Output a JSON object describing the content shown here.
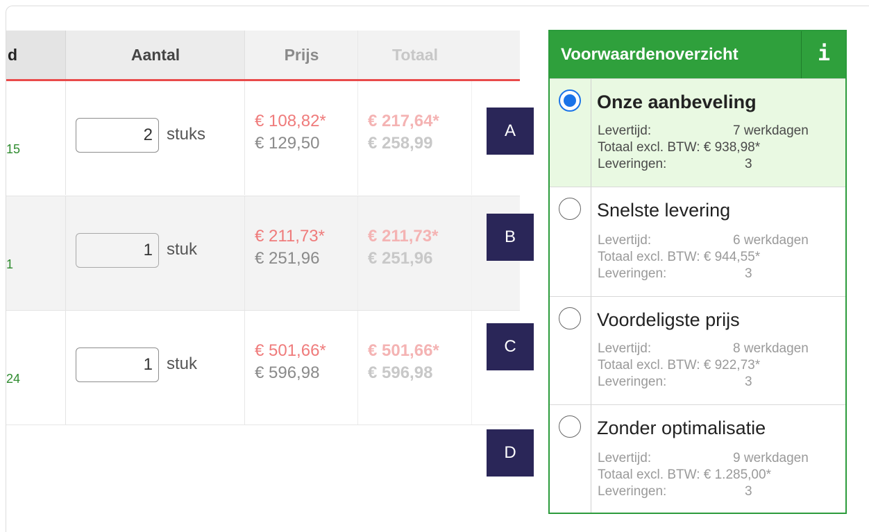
{
  "table": {
    "headers": {
      "first": "d",
      "aantal": "Aantal",
      "prijs": "Prijs",
      "totaal": "Totaal"
    },
    "rows": [
      {
        "code": "15",
        "qty": "2",
        "unit": "stuks",
        "price_sale": "€ 108,82*",
        "price_regular": "€ 129,50",
        "total_sale": "€ 217,64*",
        "total_regular": "€ 258,99"
      },
      {
        "code": "1",
        "qty": "1",
        "unit": "stuk",
        "price_sale": "€ 211,73*",
        "price_regular": "€ 251,96",
        "total_sale": "€ 211,73*",
        "total_regular": "€ 251,96"
      },
      {
        "code": "24",
        "qty": "1",
        "unit": "stuk",
        "price_sale": "€ 501,66*",
        "price_regular": "€ 596,98",
        "total_sale": "€ 501,66*",
        "total_regular": "€ 596,98"
      }
    ]
  },
  "badges": [
    "A",
    "B",
    "C",
    "D"
  ],
  "panel": {
    "title": "Voorwaardenoverzicht",
    "info_icon": "i",
    "labels": {
      "levertijd": "Levertijd:",
      "totaal": "Totaal excl. BTW:",
      "leveringen": "Leveringen:"
    },
    "options": [
      {
        "title": "Onze aanbeveling",
        "selected": true,
        "levertijd": "7 werkdagen",
        "totaal": "€ 938,98*",
        "leveringen": "3"
      },
      {
        "title": "Snelste levering",
        "selected": false,
        "levertijd": "6 werkdagen",
        "totaal": "€ 944,55*",
        "leveringen": "3"
      },
      {
        "title": "Voordeligste prijs",
        "selected": false,
        "levertijd": "8 werkdagen",
        "totaal": "€ 922,73*",
        "leveringen": "3"
      },
      {
        "title": "Zonder optimalisatie",
        "selected": false,
        "levertijd": "9 werkdagen",
        "totaal": "€ 1.285,00*",
        "leveringen": "3"
      }
    ]
  },
  "colors": {
    "accent_green": "#2fa03c",
    "selected_bg": "#e9f9e2",
    "sale_red": "#ef7b7b",
    "badge_navy": "#2a2658",
    "radio_blue": "#1a73e8"
  }
}
